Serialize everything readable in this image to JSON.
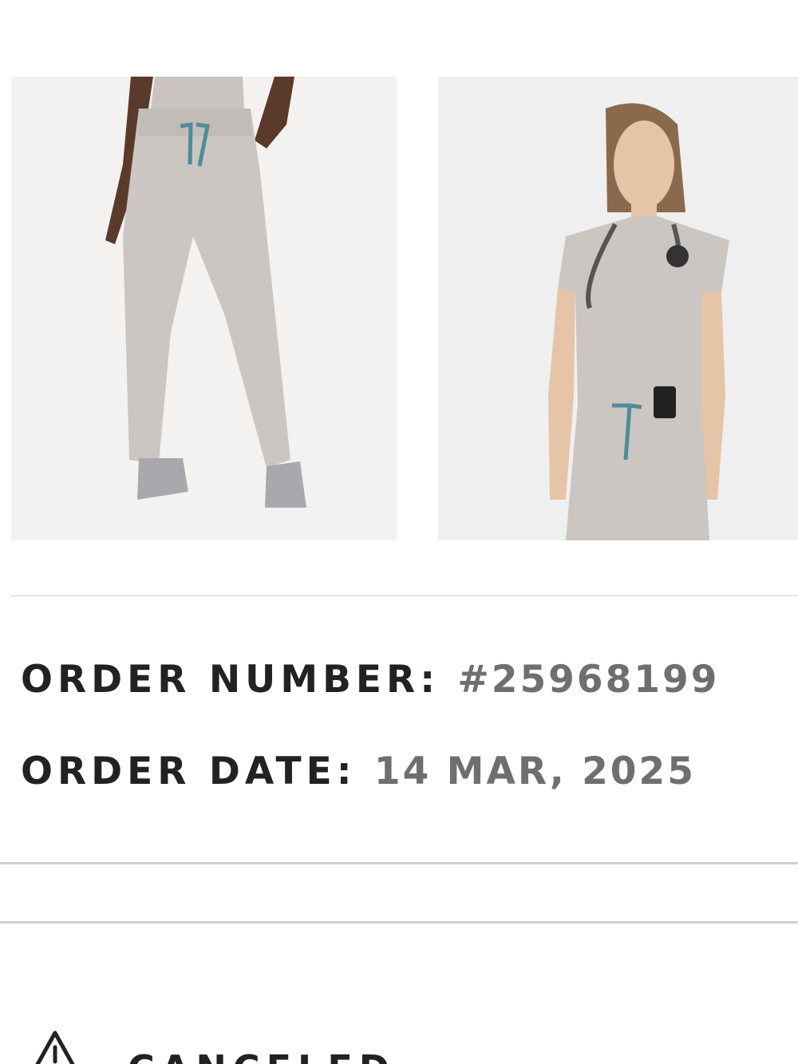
{
  "products": [
    {
      "name": "pants-product-image"
    },
    {
      "name": "top-product-image"
    }
  ],
  "order": {
    "number_label": "ORDER NUMBER",
    "number_value": "#25968199",
    "date_label": "ORDER DATE",
    "date_value": "14 MAR, 2025",
    "separator": ":"
  },
  "status": {
    "label": "CANCELED",
    "icon": "alert-triangle-icon"
  },
  "colors": {
    "label_text": "#222222",
    "value_text": "#6f6f6f",
    "scrub_color": "#cbc6c2",
    "drawstring": "#4f8c96"
  }
}
